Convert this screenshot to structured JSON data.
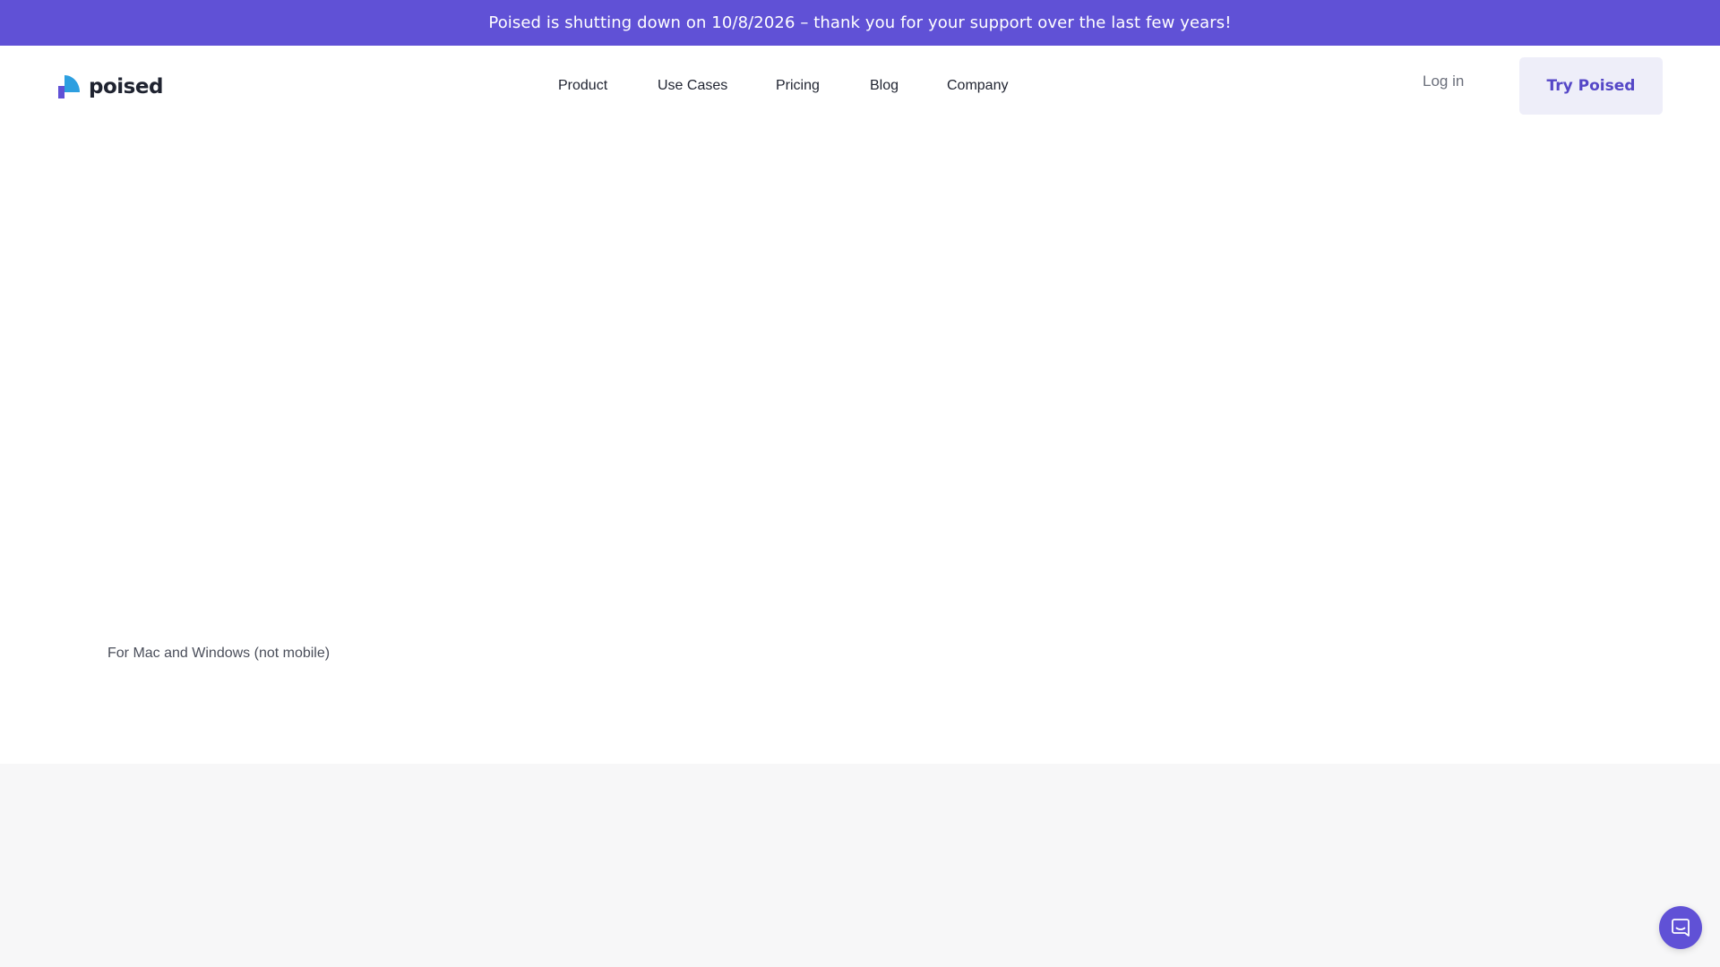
{
  "banner": {
    "text": "Poised is shutting down on 10/8/2026 – thank you for your support over the last few years!"
  },
  "header": {
    "logo_text": "poised",
    "logo_icon": "poised-logo-icon",
    "nav": [
      {
        "label": "Product"
      },
      {
        "label": "Use Cases"
      },
      {
        "label": "Pricing"
      },
      {
        "label": "Blog"
      },
      {
        "label": "Company"
      }
    ],
    "login_label": "Log in",
    "cta_label": "Try Poised"
  },
  "hero": {
    "platform_note": "For Mac and Windows (not mobile)"
  },
  "chat": {
    "icon": "chat-bubble-icon"
  },
  "colors": {
    "banner_bg": "#6051d6",
    "cta_bg": "#eeeef9",
    "cta_text": "#5547c7",
    "lower_bg": "#f7f7f8",
    "chat_bg": "#6051d6",
    "logo_blue": "#2d9fe0",
    "logo_purple": "#6051d6"
  }
}
